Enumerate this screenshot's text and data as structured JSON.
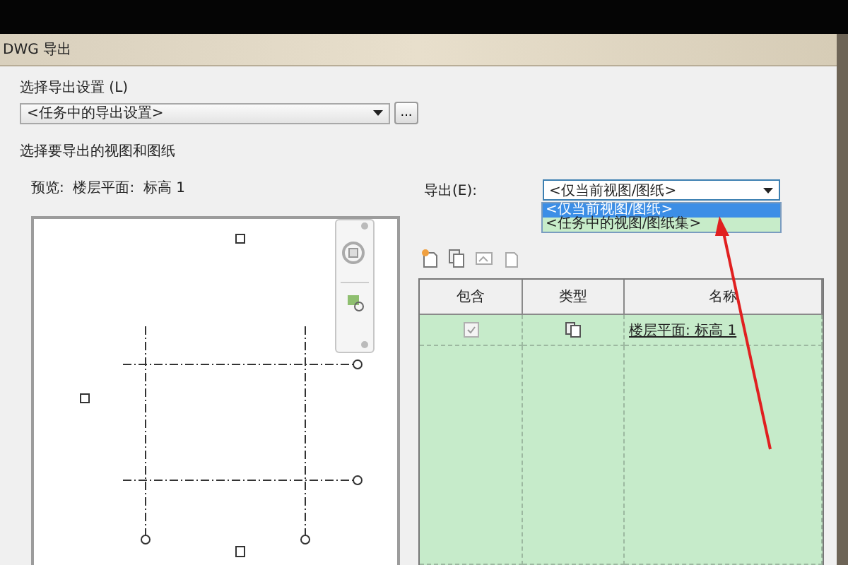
{
  "window": {
    "title": "DWG 导出"
  },
  "export_setup": {
    "label": "选择导出设置 (L)",
    "value": "<任务中的导出设置>",
    "browse_button": "..."
  },
  "group": {
    "title": "选择要导出的视图和图纸"
  },
  "preview": {
    "label": "预览:  楼层平面:  标高 1"
  },
  "export": {
    "label": "导出(E):",
    "value": "<仅当前视图/图纸>",
    "options": [
      {
        "label": "<仅当前视图/图纸>",
        "selected": true
      },
      {
        "label": "<任务中的视图/图纸集>",
        "selected": false
      }
    ]
  },
  "table": {
    "columns": [
      "包含",
      "类型",
      "名称"
    ],
    "rows": [
      {
        "checked": true,
        "name": "楼层平面: 标高 1"
      }
    ]
  }
}
